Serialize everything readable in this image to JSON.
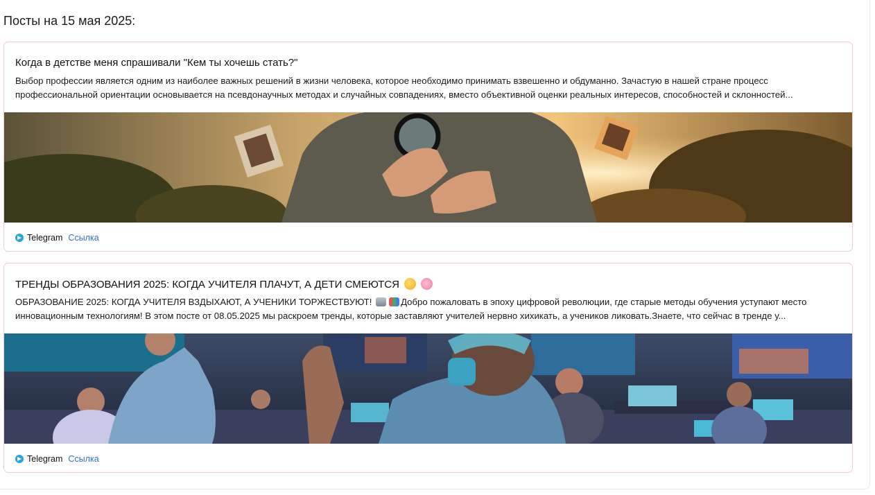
{
  "heading": "Посты на 15 мая 2025:",
  "posts": [
    {
      "title": "Когда в детстве меня спрашивали \"Кем ты хочешь стать?\"",
      "excerpt": "Выбор профессии является одним из наиболее важных решений в жизни человека, которое необходимо принимать взвешенно и обдуманно. Зачастую в нашей стране процесс профессиональной ориентации основывается на псевдонаучных методах и случайных совпадениях, вместо объективной оценки реальных интересов, способностей и склонностей...",
      "source": "Telegram",
      "link_label": "Ссылка",
      "image_icon": "person-with-magnifying-glass-image"
    },
    {
      "title": "ТРЕНДЫ ОБРАЗОВАНИЯ 2025: КОГДА УЧИТЕЛЯ ПЛАЧУТ, А ДЕТИ СМЕЮТСЯ",
      "excerpt_start": "ОБРАЗОВАНИЕ 2025: КОГДА УЧИТЕЛЯ ВЗДЫХАЮТ, А УЧЕНИКИ ТОРЖЕСТВУЮТ!",
      "excerpt_rest": "Добро пожаловать в эпоху цифровой революции, где старые методы обучения уступают место инновационным технологиям! В этом посте от 08.05.2025 мы раскроем тренды, которые заставляют учителей нервно хихикать, а учеников ликовать.Знаете, что сейчас в тренде у...",
      "source": "Telegram",
      "link_label": "Ссылка",
      "title_emoji": [
        "rolling-laughing-emoji",
        "brain-emoji"
      ],
      "excerpt_emoji": [
        "robot-emoji",
        "books-emoji"
      ],
      "image_icon": "futuristic-classroom-image"
    }
  ],
  "colors": {
    "card_border": "#f3c9d6",
    "link": "#2f6fd8",
    "telegram": "#2aa3e0"
  }
}
